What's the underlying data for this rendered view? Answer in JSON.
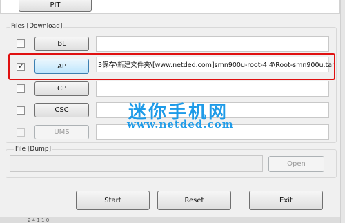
{
  "pit_button": "PIT",
  "files_group": {
    "label": "Files [Download]"
  },
  "rows": [
    {
      "key": "bl",
      "label": "BL",
      "checked": false,
      "path": ""
    },
    {
      "key": "ap",
      "label": "AP",
      "checked": true,
      "path": "3保存\\新建文件夹\\[www.netded.com]smn900u-root-4.4\\Root-smn900u.tar"
    },
    {
      "key": "cp",
      "label": "CP",
      "checked": false,
      "path": ""
    },
    {
      "key": "csc",
      "label": "CSC",
      "checked": false,
      "path": ""
    },
    {
      "key": "ums",
      "label": "UMS",
      "checked": false,
      "path": ""
    }
  ],
  "dump_group": {
    "label": "File [Dump]",
    "open_label": "Open"
  },
  "actions": {
    "start": "Start",
    "reset": "Reset",
    "exit": "Exit"
  },
  "watermark": {
    "title": "迷你手机网",
    "url": "www.netded.com"
  },
  "footer_text": "2 4 1 1 0",
  "colors": {
    "highlight": "#e01010",
    "watermark": "#1e9be8",
    "hot_button": "#bee6fd"
  }
}
